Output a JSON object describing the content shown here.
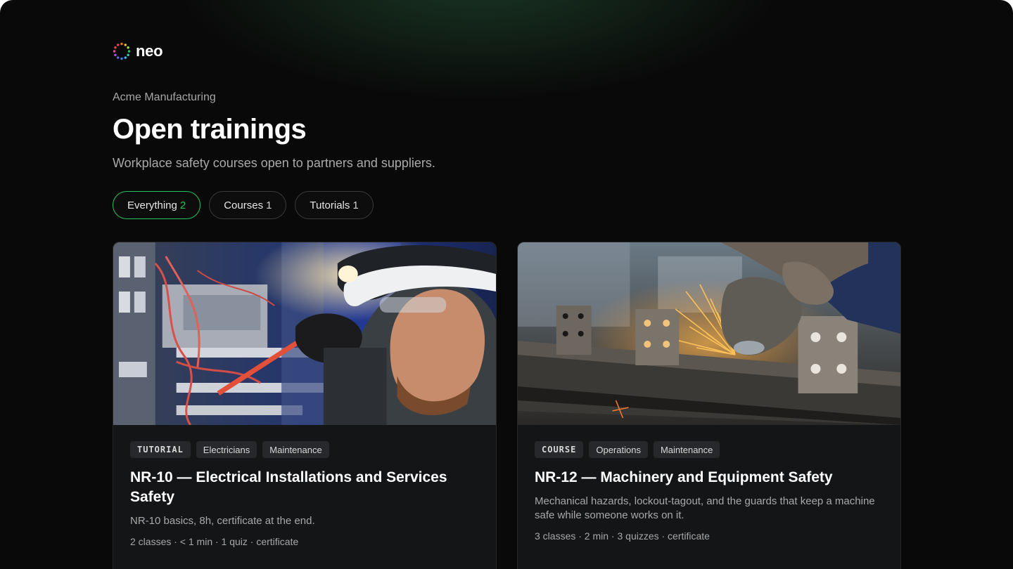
{
  "brand": {
    "name": "neo"
  },
  "org": "Acme Manufacturing",
  "page": {
    "title": "Open trainings",
    "subtitle": "Workplace safety courses open to partners and suppliers."
  },
  "filters": [
    {
      "label": "Everything",
      "count": "2",
      "active": true
    },
    {
      "label": "Courses",
      "count": "1",
      "active": false
    },
    {
      "label": "Tutorials",
      "count": "1",
      "active": false
    }
  ],
  "cards": [
    {
      "type": "TUTORIAL",
      "tags": [
        "Electricians",
        "Maintenance"
      ],
      "title": "NR-10 — Electrical Installations and Services Safety",
      "description": "NR-10 basics, 8h, certificate at the end.",
      "meta": "2 classes · < 1 min · 1 quiz · certificate"
    },
    {
      "type": "COURSE",
      "tags": [
        "Operations",
        "Maintenance"
      ],
      "title": "NR-12 — Machinery and Equipment Safety",
      "description": "Mechanical hazards, lockout-tagout, and the guards that keep a machine safe while someone works on it.",
      "meta": "3 classes · 2 min · 3 quizzes · certificate"
    }
  ],
  "colors": {
    "accent": "#22c55e",
    "background": "#090909",
    "card": "#141517"
  }
}
